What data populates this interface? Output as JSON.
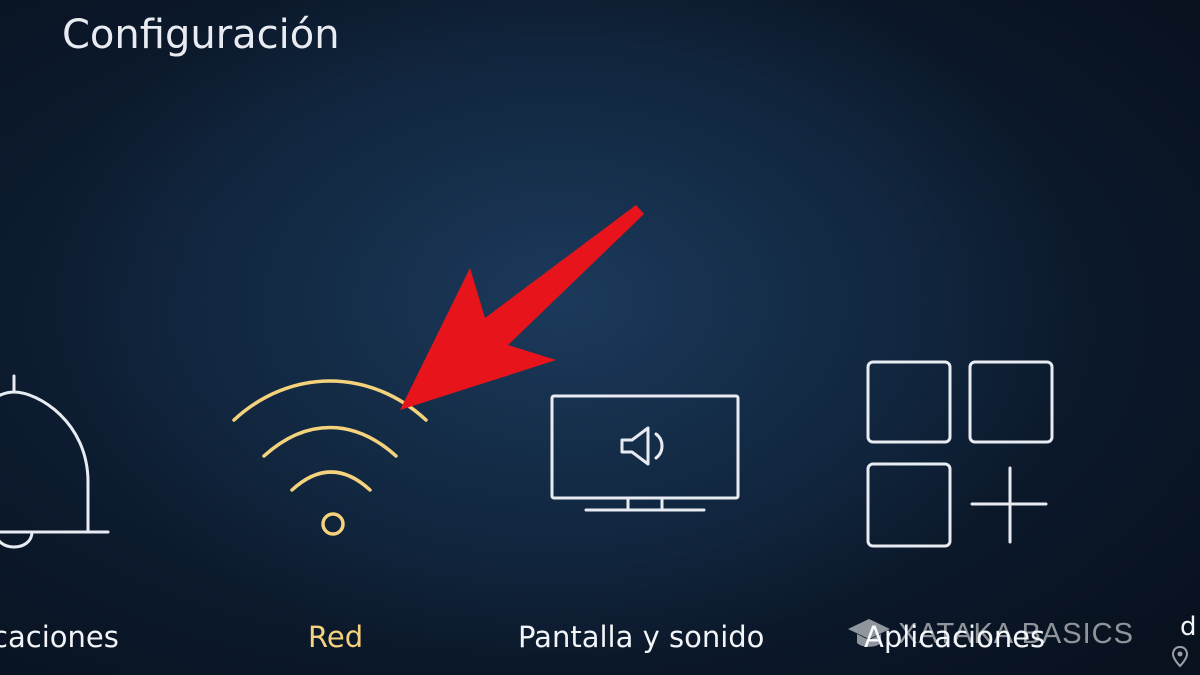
{
  "page": {
    "title": "Configuración"
  },
  "tiles": [
    {
      "id": "notifications",
      "label": "icaciones",
      "icon": "bell-icon",
      "focused": false
    },
    {
      "id": "network",
      "label": "Red",
      "icon": "wifi-icon",
      "focused": true
    },
    {
      "id": "display",
      "label": "Pantalla y sonido",
      "icon": "tv-speaker-icon",
      "focused": false
    },
    {
      "id": "apps",
      "label": "Aplicaciones",
      "icon": "apps-grid-icon",
      "focused": false
    },
    {
      "id": "next",
      "label": "d",
      "icon": "",
      "focused": false
    }
  ],
  "watermark": {
    "text": "XATAKA BASICS",
    "icon": "graduation-cap-icon"
  },
  "colors": {
    "background": "#0b1626",
    "focused_accent": "#f5d27c",
    "icon_outline": "#e8ecf2",
    "arrow": "#e8141b"
  }
}
